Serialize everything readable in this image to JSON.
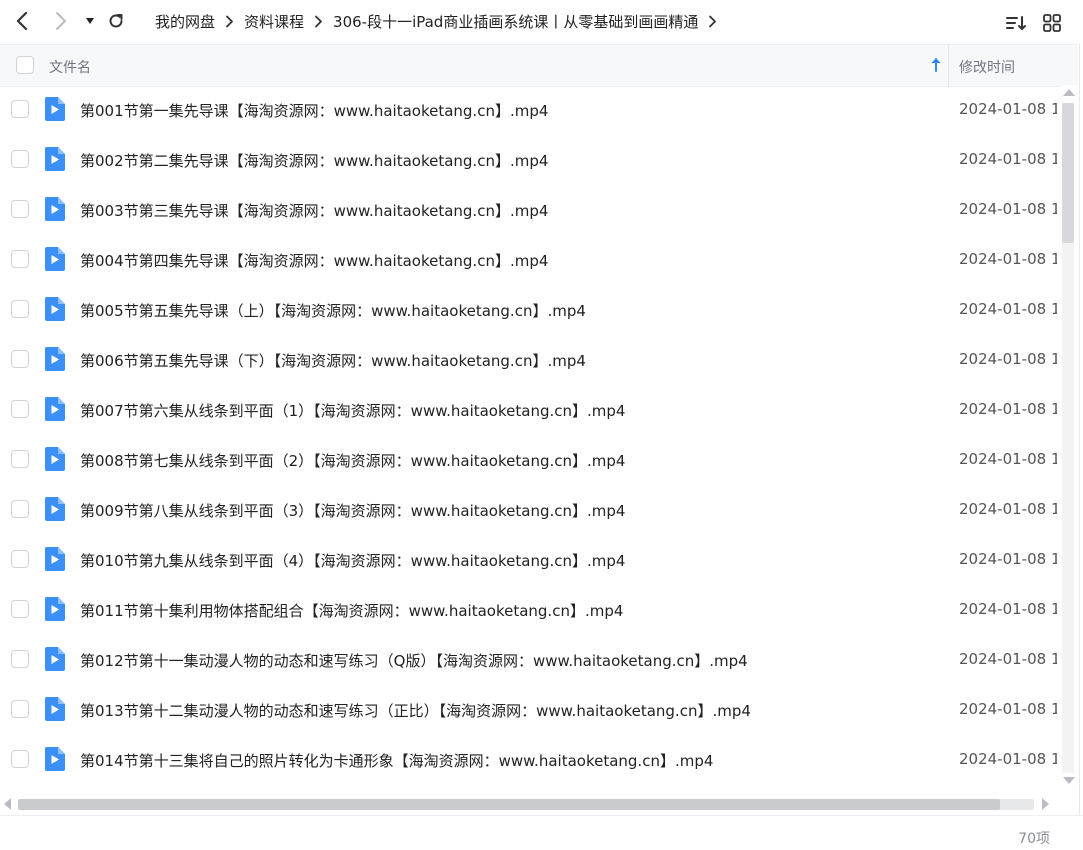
{
  "breadcrumb": [
    "我的网盘",
    "资料课程",
    "306-段十一iPad商业插画系统课丨从零基础到画画精通"
  ],
  "header": {
    "name_label": "文件名",
    "time_label": "修改时间"
  },
  "files": [
    {
      "name": "第001节第一集先导课【海淘资源网：www.haitaoketang.cn】.mp4",
      "time": "2024-01-08 1"
    },
    {
      "name": "第002节第二集先导课【海淘资源网：www.haitaoketang.cn】.mp4",
      "time": "2024-01-08 1"
    },
    {
      "name": "第003节第三集先导课【海淘资源网：www.haitaoketang.cn】.mp4",
      "time": "2024-01-08 1"
    },
    {
      "name": "第004节第四集先导课【海淘资源网：www.haitaoketang.cn】.mp4",
      "time": "2024-01-08 1"
    },
    {
      "name": "第005节第五集先导课（上）【海淘资源网：www.haitaoketang.cn】.mp4",
      "time": "2024-01-08 1"
    },
    {
      "name": "第006节第五集先导课（下）【海淘资源网：www.haitaoketang.cn】.mp4",
      "time": "2024-01-08 1"
    },
    {
      "name": "第007节第六集从线条到平面（1）【海淘资源网：www.haitaoketang.cn】.mp4",
      "time": "2024-01-08 1"
    },
    {
      "name": "第008节第七集从线条到平面（2）【海淘资源网：www.haitaoketang.cn】.mp4",
      "time": "2024-01-08 1"
    },
    {
      "name": "第009节第八集从线条到平面（3）【海淘资源网：www.haitaoketang.cn】.mp4",
      "time": "2024-01-08 1"
    },
    {
      "name": "第010节第九集从线条到平面（4）【海淘资源网：www.haitaoketang.cn】.mp4",
      "time": "2024-01-08 1"
    },
    {
      "name": "第011节第十集利用物体搭配组合【海淘资源网：www.haitaoketang.cn】.mp4",
      "time": "2024-01-08 1"
    },
    {
      "name": "第012节第十一集动漫人物的动态和速写练习（Q版）【海淘资源网：www.haitaoketang.cn】.mp4",
      "time": "2024-01-08 1"
    },
    {
      "name": "第013节第十二集动漫人物的动态和速写练习（正比）【海淘资源网：www.haitaoketang.cn】.mp4",
      "time": "2024-01-08 1"
    },
    {
      "name": "第014节第十三集将自己的照片转化为卡通形象【海淘资源网：www.haitaoketang.cn】.mp4",
      "time": "2024-01-08 1"
    }
  ],
  "status": {
    "count_label": "70项"
  },
  "icons": {
    "back": "chevron-left-icon",
    "forward": "chevron-right-icon",
    "history": "caret-down-icon",
    "refresh": "refresh-icon",
    "sort": "sort-list-icon",
    "view": "grid-view-icon",
    "file": "video-file-icon",
    "sort_direction": "arrow-up-icon"
  },
  "colors": {
    "accent": "#2f86f6",
    "file_icon": "#3b8ff6"
  }
}
